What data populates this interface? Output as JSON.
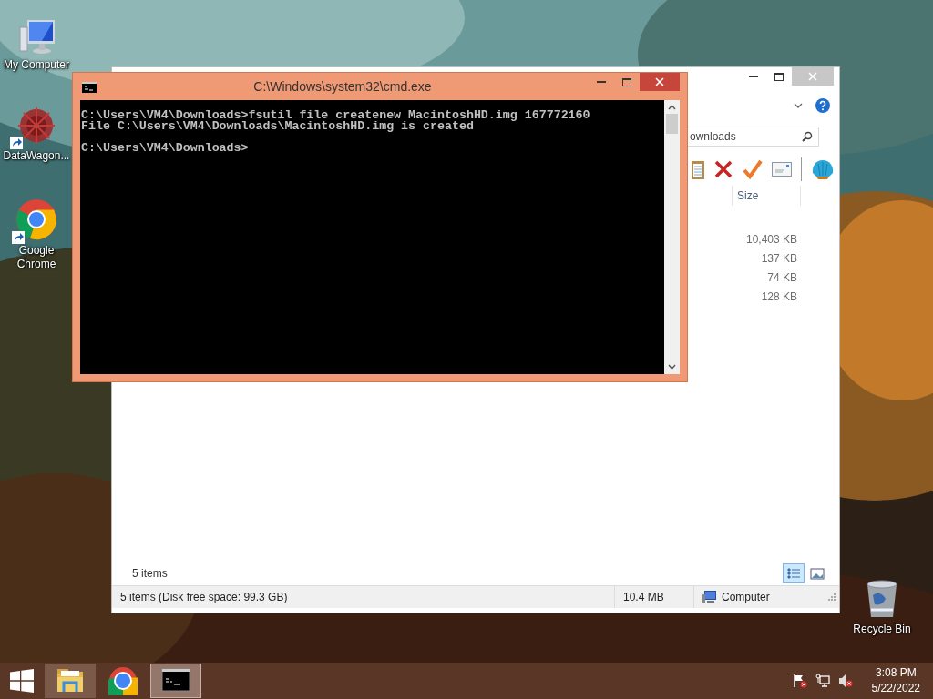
{
  "desktop_icons": [
    {
      "kind": "computer",
      "label": "My Computer",
      "shortcut": false
    },
    {
      "kind": "app",
      "label": "DataWagon...",
      "shortcut": true
    },
    {
      "kind": "chrome",
      "label": "Google Chrome",
      "shortcut": true
    },
    {
      "kind": "recycle",
      "label": "Recycle Bin",
      "shortcut": false
    }
  ],
  "explorer": {
    "search": {
      "value": "ownloads"
    },
    "columns": [
      {
        "label": "Size"
      }
    ],
    "rows": [
      {
        "size": "10,403 KB"
      },
      {
        "size": "137 KB"
      },
      {
        "size": "74 KB"
      },
      {
        "size": "128 KB"
      }
    ],
    "item_count": "5 items",
    "views": [
      {
        "kind": "details",
        "selected": true
      },
      {
        "kind": "thumbnails",
        "selected": false
      }
    ],
    "status_bar": {
      "summary": "5 items (Disk free space: 99.3 GB)",
      "size": "10.4 MB",
      "location": "Computer"
    }
  },
  "console": {
    "title": "C:\\Windows\\system32\\cmd.exe",
    "text": "C:\\Users\\VM4\\Downloads>fsutil file createnew MacintoshHD.img 167772160\nFile C:\\Users\\VM4\\Downloads\\MacintoshHD.img is created\n\nC:\\Users\\VM4\\Downloads>"
  },
  "taskbar": {
    "buttons": [
      {
        "kind": "explorer",
        "running": true,
        "selected": false
      },
      {
        "kind": "chrome",
        "running": false,
        "selected": false
      },
      {
        "kind": "console",
        "running": true,
        "selected": true
      }
    ],
    "time": "3:08 PM",
    "date": "5/22/2022"
  }
}
